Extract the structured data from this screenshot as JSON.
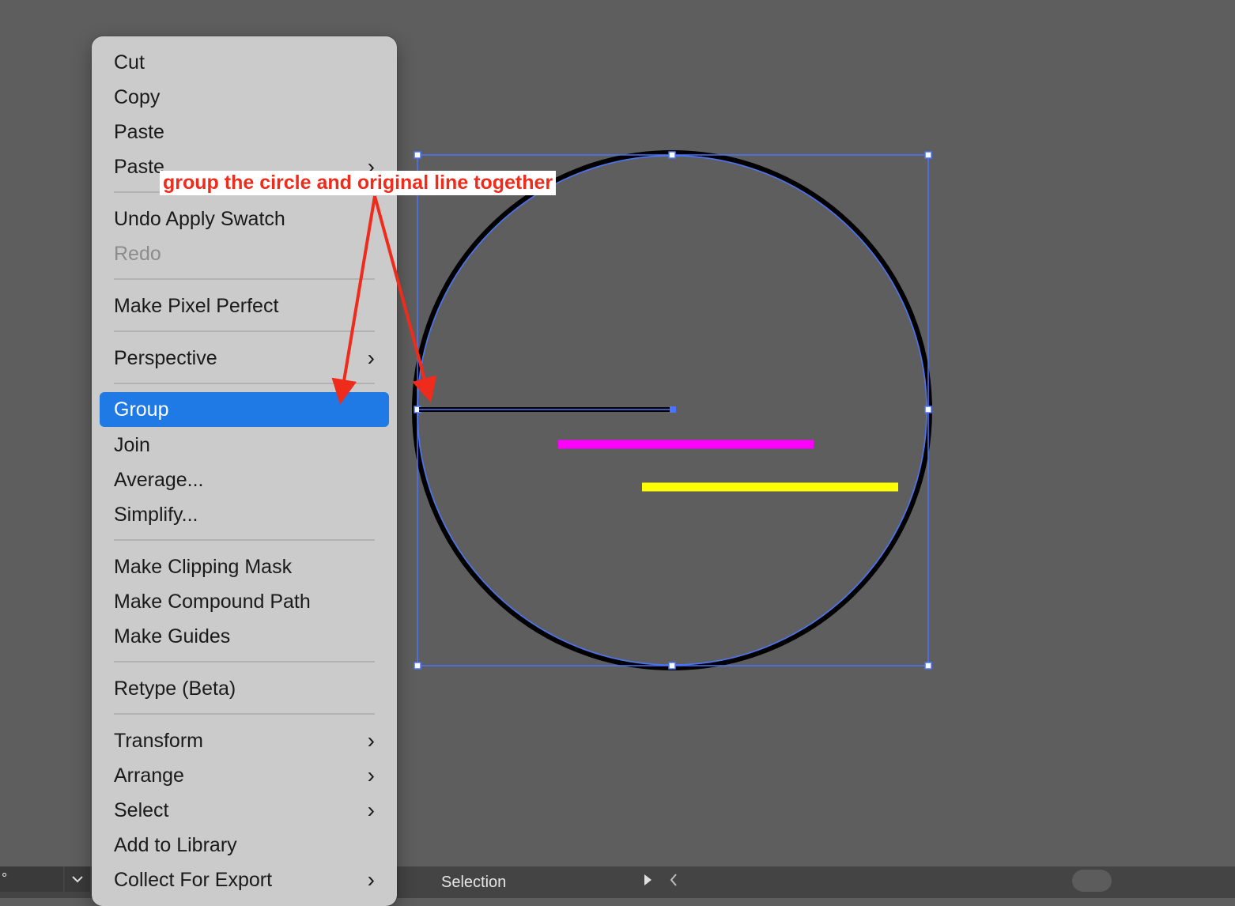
{
  "menu": {
    "items": [
      {
        "label": "Cut"
      },
      {
        "label": "Copy"
      },
      {
        "label": "Paste"
      },
      {
        "label": "Paste"
      },
      {
        "label": "Undo Apply Swatch"
      },
      {
        "label": "Redo"
      },
      {
        "label": "Make Pixel Perfect"
      },
      {
        "label": "Perspective"
      },
      {
        "label": "Group"
      },
      {
        "label": "Join"
      },
      {
        "label": "Average..."
      },
      {
        "label": "Simplify..."
      },
      {
        "label": "Make Clipping Mask"
      },
      {
        "label": "Make Compound Path"
      },
      {
        "label": "Make Guides"
      },
      {
        "label": "Retype (Beta)"
      },
      {
        "label": "Transform"
      },
      {
        "label": "Arrange"
      },
      {
        "label": "Select"
      },
      {
        "label": "Add to Library"
      },
      {
        "label": "Collect For Export"
      }
    ],
    "highlight_color": "#1f7ae6"
  },
  "annotation": {
    "text": "group the circle and original line together",
    "color": "#ef2b1c"
  },
  "canvas": {
    "line_colors": {
      "magenta": "#ff00ff",
      "yellow": "#ffff00",
      "selection": "#4a74ff"
    }
  },
  "status_bar": {
    "left_value": "°",
    "tool_name": "Selection"
  }
}
